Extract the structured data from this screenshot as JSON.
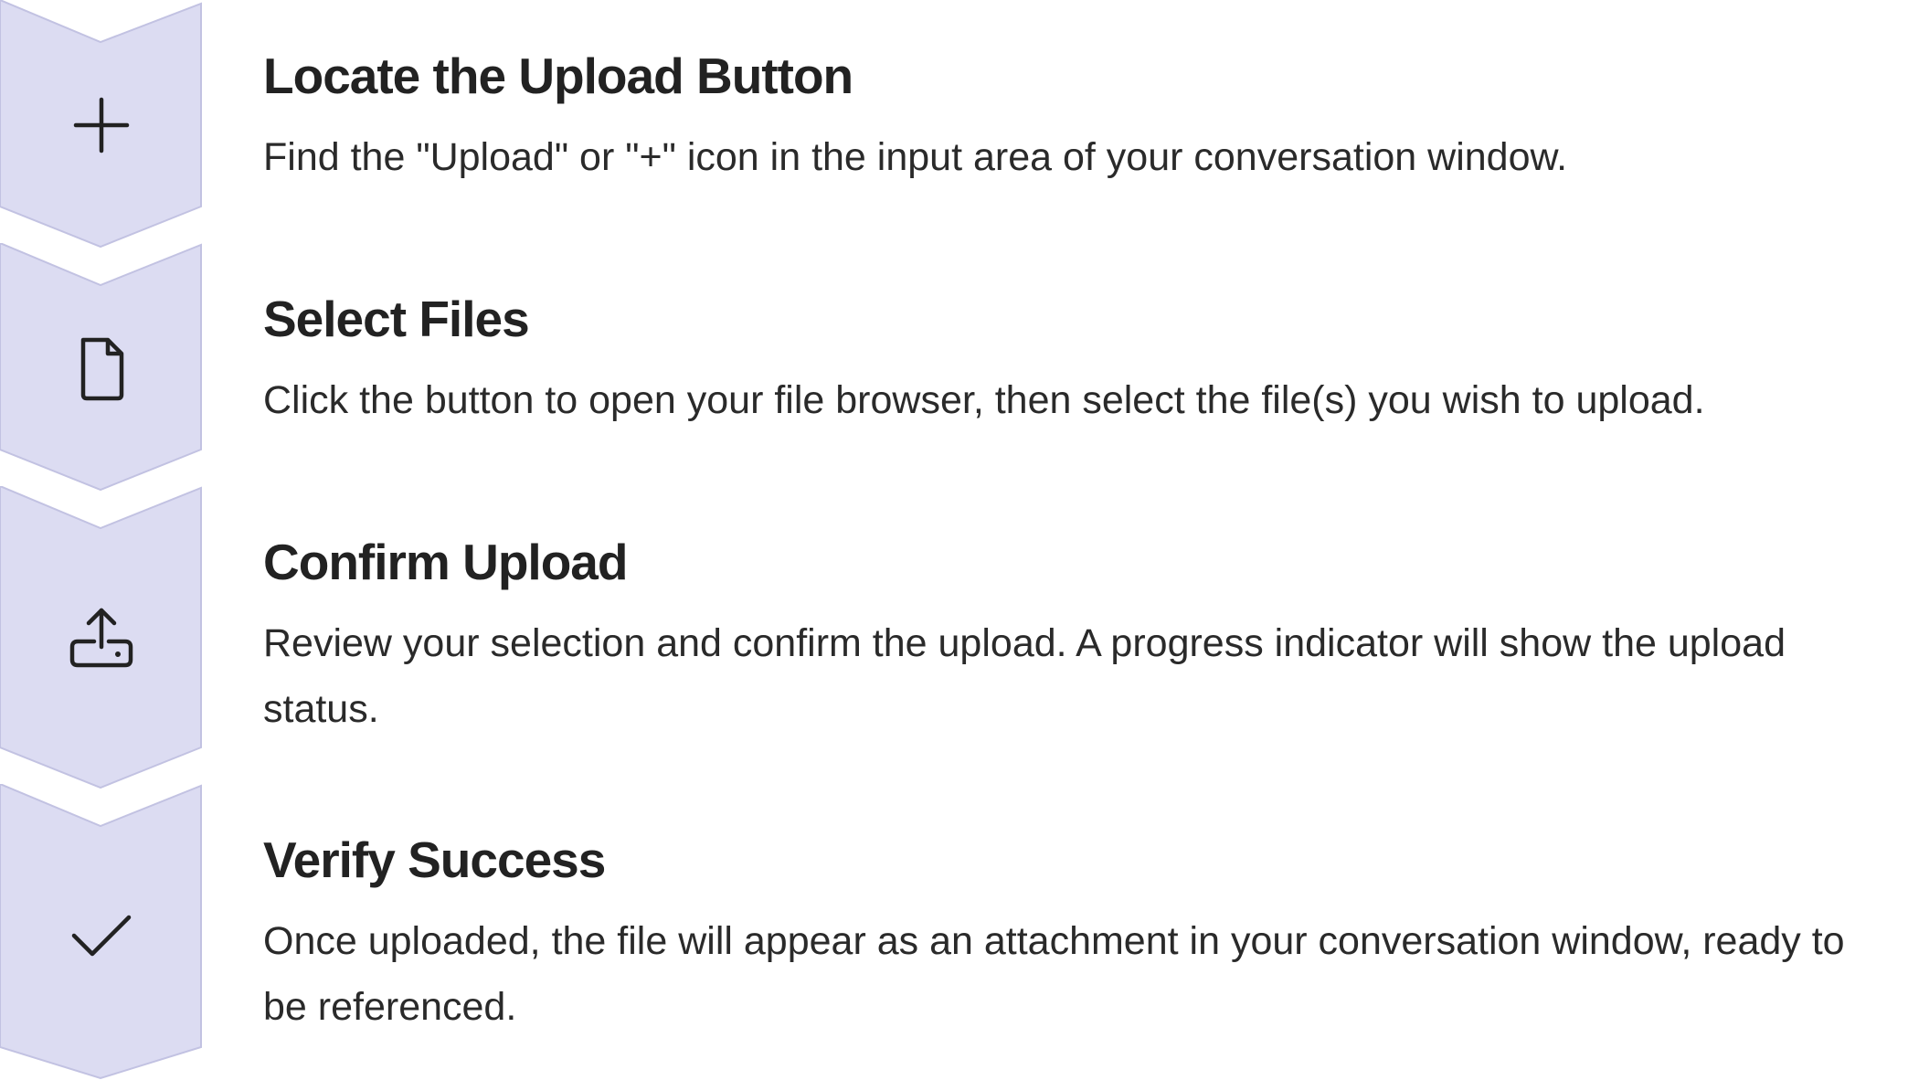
{
  "colors": {
    "chevron_fill": "#dcdcf2",
    "chevron_stroke": "#c2c2e2",
    "icon_stroke": "#222222",
    "title_text": "#222222",
    "body_text": "#2a2a2a"
  },
  "steps": [
    {
      "icon": "plus-icon",
      "title": "Locate the Upload Button",
      "description": "Find the \"Upload\" or \"+\" icon in the input area of your conversation window."
    },
    {
      "icon": "file-icon",
      "title": "Select Files",
      "description": "Click the button to open your file browser, then select the file(s) you wish to upload."
    },
    {
      "icon": "upload-tray-icon",
      "title": "Confirm Upload",
      "description": "Review your selection and confirm the upload. A progress indicator will show the upload status."
    },
    {
      "icon": "checkmark-icon",
      "title": "Verify Success",
      "description": "Once uploaded, the file will appear as an attachment in your conversation window, ready to be referenced."
    }
  ]
}
